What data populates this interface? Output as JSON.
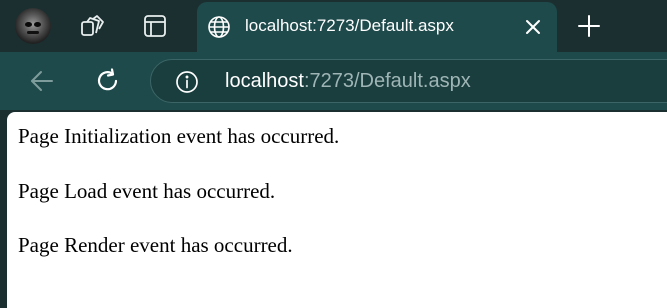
{
  "browser": {
    "profile_avatar": "profile-avatar",
    "tab": {
      "title": "localhost:7273/Default.aspx",
      "icon": "globe-icon"
    },
    "address_bar": {
      "host": "localhost",
      "path": ":7273/Default.aspx"
    },
    "icons": {
      "collections": "collections-icon",
      "tab_actions": "tab-actions-icon",
      "close": "close-icon",
      "new_tab": "plus-icon",
      "back": "back-arrow-icon",
      "refresh": "refresh-icon",
      "site_info": "info-icon"
    },
    "colors": {
      "frame": "#1b2f30",
      "active_tab": "#1f4a4b",
      "address_bg": "#1a3d3e",
      "url_path": "#9fb5b5"
    }
  },
  "page": {
    "messages": [
      "Page Initialization event has occurred.",
      "Page Load event has occurred.",
      "Page Render event has occurred."
    ]
  }
}
